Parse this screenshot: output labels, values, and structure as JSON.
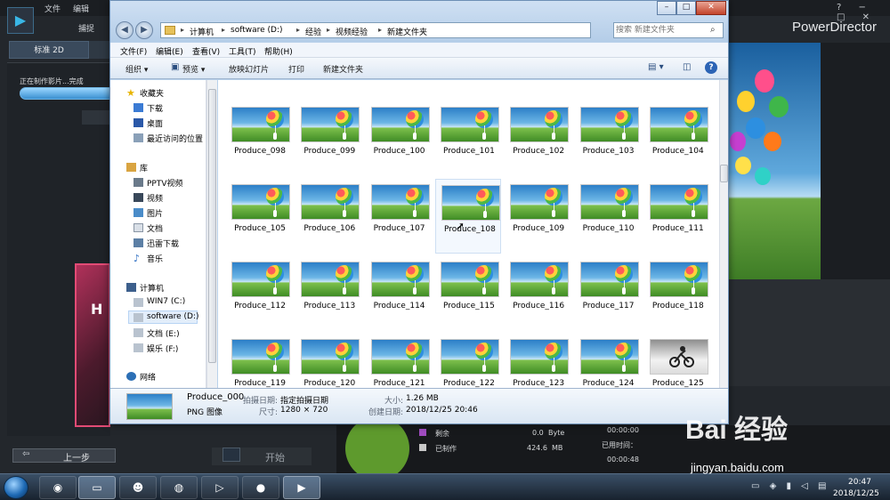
{
  "powerdirector": {
    "menu": [
      "文件",
      "编辑"
    ],
    "capture_label": "捕捉",
    "app_title": "PowerDirector",
    "window_controls": "? − □ ✕",
    "tab_2d": "标准 2D",
    "status_text": "正在制作影片...完成",
    "back_button": "上一步",
    "back_arrow": "⇦",
    "start_button": "开始",
    "stats": [
      {
        "label": "剩余",
        "value": "0.0",
        "unit": "Byte",
        "color": "#a04cc0"
      },
      {
        "label": "已制作",
        "value": "424.6",
        "unit": "MB",
        "color": "#c8c8c8"
      }
    ],
    "elapsed_label": "已用时间：",
    "time_1": "00:00:00",
    "time_2": "00:00:48"
  },
  "explorer": {
    "address": {
      "crumbs": [
        "计算机",
        "software (D:)",
        "经验",
        "视频经验",
        "新建文件夹"
      ]
    },
    "search": {
      "placeholder": "搜索 新建文件夹"
    },
    "menus": [
      "文件(F)",
      "编辑(E)",
      "查看(V)",
      "工具(T)",
      "帮助(H)"
    ],
    "toolbar": {
      "organize": "组织 ▾",
      "preview": "预览 ▾",
      "slideshow": "放映幻灯片",
      "print": "打印",
      "new_folder": "新建文件夹",
      "help": "?"
    },
    "nav": {
      "favorites_header": "收藏夹",
      "favorites": [
        "下载",
        "桌面",
        "最近访问的位置"
      ],
      "library_header": "库",
      "library": [
        "PPTV视频",
        "视频",
        "图片",
        "文档",
        "迅雷下载",
        "音乐"
      ],
      "computer_header": "计算机",
      "drives": [
        "WIN7 (C:)",
        "software (D:)",
        "文档 (E:)",
        "娱乐 (F:)"
      ],
      "network_header": "网络"
    },
    "files": [
      "Produce_098",
      "Produce_099",
      "Produce_100",
      "Produce_101",
      "Produce_102",
      "Produce_103",
      "Produce_104",
      "Produce_105",
      "Produce_106",
      "Produce_107",
      "Produce_108",
      "Produce_109",
      "Produce_110",
      "Produce_111",
      "Produce_112",
      "Produce_113",
      "Produce_114",
      "Produce_115",
      "Produce_116",
      "Produce_117",
      "Produce_118",
      "Produce_119",
      "Produce_120",
      "Produce_121",
      "Produce_122",
      "Produce_123",
      "Produce_124",
      "Produce_125"
    ],
    "selected_file": "Produce_108",
    "details": {
      "name": "Produce_000",
      "type": "PNG 图像",
      "shot_date_label": "拍摄日期:",
      "shot_date_value": "指定拍摄日期",
      "dimensions_label": "尺寸:",
      "dimensions_value": "1280 × 720",
      "size_label": "大小:",
      "size_value": "1.26 MB",
      "created_label": "创建日期:",
      "created_value": "2018/12/25 20:46"
    }
  },
  "taskbar": {
    "time": "20:47",
    "date": "2018/12/25"
  },
  "watermark": {
    "brand": "Bai 经验",
    "url": "jingyan.baidu.com"
  }
}
